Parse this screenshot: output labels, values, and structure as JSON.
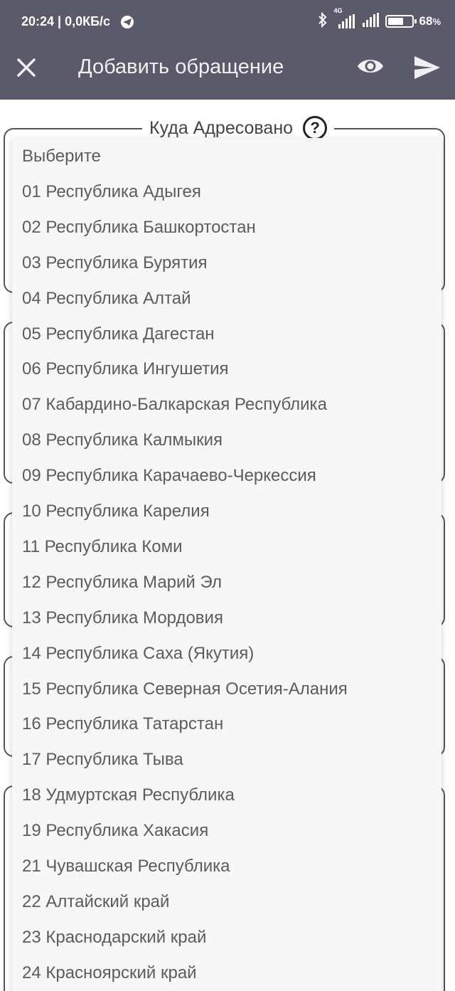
{
  "status_bar": {
    "time": "20:24",
    "net_speed": "0,0КБ/с",
    "network": "4G",
    "battery_pct": "68",
    "battery_unit": "%",
    "battery_level": 0.68
  },
  "app_bar": {
    "title": "Добавить обращение",
    "close_icon": "close-icon",
    "preview_icon": "eye-icon",
    "send_icon": "send-icon"
  },
  "section": {
    "legend": "Куда Адресовано",
    "help": "?"
  },
  "dropdown": {
    "options": [
      "Выберите",
      "01 Республика Адыгея",
      "02 Республика Башкортостан",
      "03 Республика Бурятия",
      "04 Республика Алтай",
      "05 Республика Дагестан",
      "06 Республика Ингушетия",
      "07 Кабардино-Балкарская Республика",
      "08 Республика Калмыкия",
      "09 Республика Карачаево-Черкессия",
      "10 Республика Карелия",
      "11 Республика Коми",
      "12 Республика Марий Эл",
      "13 Республика Мордовия",
      "14 Республика Саха (Якутия)",
      "15 Республика Северная Осетия-Алания",
      "16 Республика Татарстан",
      "17 Республика Тыва",
      "18 Удмуртская Республика",
      "19 Республика Хакасия",
      "21 Чувашская Республика",
      "22 Алтайский край",
      "23 Краснодарский край",
      "24 Красноярский край"
    ]
  },
  "colors": {
    "app_bar": "#5a5a6b",
    "dropdown_bg": "#f7f7f7",
    "option_text": "#5c5c5c"
  }
}
